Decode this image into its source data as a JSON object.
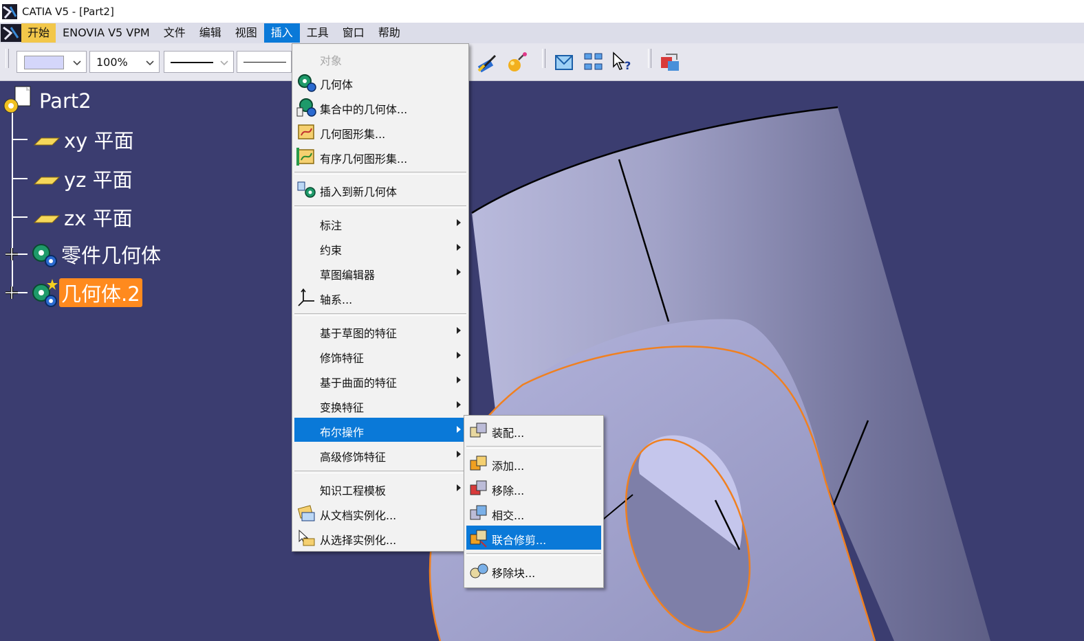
{
  "window": {
    "title": "CATIA V5 - [Part2]"
  },
  "menubar": {
    "items": [
      {
        "id": "start",
        "label": "开始"
      },
      {
        "id": "enovia",
        "label": "ENOVIA V5 VPM"
      },
      {
        "id": "file",
        "label": "文件"
      },
      {
        "id": "edit",
        "label": "编辑"
      },
      {
        "id": "view",
        "label": "视图"
      },
      {
        "id": "insert",
        "label": "插入",
        "open": true
      },
      {
        "id": "tools",
        "label": "工具"
      },
      {
        "id": "window",
        "label": "窗口"
      },
      {
        "id": "help",
        "label": "帮助"
      }
    ]
  },
  "toolbar": {
    "color_combo": "",
    "transparency_combo": "100%",
    "icons": [
      "painter-icon",
      "sphere-wand-icon",
      "envelope-icon",
      "grid-select-icon",
      "whats-this-icon",
      "gallery-icon"
    ]
  },
  "tree": {
    "root": "Part2",
    "nodes": [
      {
        "label": "xy 平面",
        "icon": "plane-icon"
      },
      {
        "label": "yz 平面",
        "icon": "plane-icon"
      },
      {
        "label": "zx 平面",
        "icon": "plane-icon"
      },
      {
        "label": "零件几何体",
        "icon": "body-gear-icon",
        "expandable": true
      },
      {
        "label": "几何体.2",
        "icon": "body-gear-icon",
        "expandable": true,
        "selected": true
      }
    ]
  },
  "insert_menu": {
    "items": [
      {
        "label": "对象",
        "disabled": true
      },
      {
        "label": "几何体",
        "icon": "body-icon"
      },
      {
        "label": "集合中的几何体...",
        "icon": "body-in-set-icon"
      },
      {
        "label": "几何图形集...",
        "icon": "geometrical-set-icon"
      },
      {
        "label": "有序几何图形集...",
        "icon": "ordered-geometrical-set-icon"
      },
      {
        "label": "插入到新几何体",
        "icon": "insert-new-body-icon"
      },
      {
        "label": "标注",
        "submenu": true
      },
      {
        "label": "约束",
        "submenu": true
      },
      {
        "label": "草图编辑器",
        "submenu": true
      },
      {
        "label": "轴系...",
        "icon": "axis-system-icon"
      },
      {
        "label": "基于草图的特征",
        "submenu": true
      },
      {
        "label": "修饰特征",
        "submenu": true
      },
      {
        "label": "基于曲面的特征",
        "submenu": true
      },
      {
        "label": "变换特征",
        "submenu": true
      },
      {
        "label": "布尔操作",
        "submenu": true,
        "highlighted": true
      },
      {
        "label": "高级修饰特征",
        "submenu": true
      },
      {
        "label": "知识工程模板",
        "submenu": true
      },
      {
        "label": "从文档实例化...",
        "icon": "instantiate-from-document-icon"
      },
      {
        "label": "从选择实例化...",
        "icon": "instantiate-from-selection-icon"
      }
    ]
  },
  "boolean_menu": {
    "items": [
      {
        "label": "装配...",
        "icon": "assemble-icon"
      },
      {
        "label": "添加...",
        "icon": "add-icon"
      },
      {
        "label": "移除...",
        "icon": "remove-icon"
      },
      {
        "label": "相交...",
        "icon": "intersect-icon"
      },
      {
        "label": "联合修剪...",
        "icon": "union-trim-icon",
        "highlighted": true
      },
      {
        "label": "移除块...",
        "icon": "remove-lump-icon"
      }
    ]
  },
  "colors": {
    "menu_highlight": "#0a79d8",
    "tree_selection": "#ff8a1e",
    "viewport_bg": "#3b3d70",
    "edge_highlight": "#f08020"
  }
}
